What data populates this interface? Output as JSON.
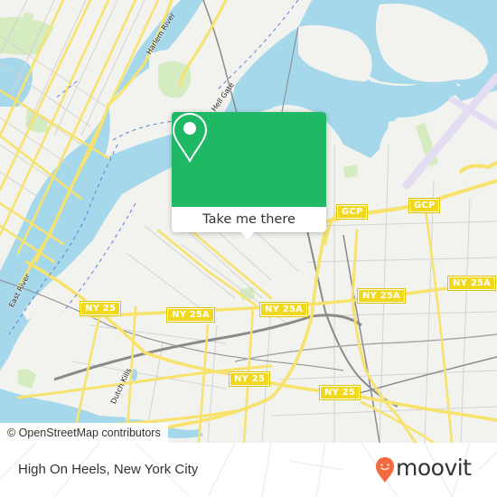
{
  "map": {
    "colors": {
      "land": "#f2f2ee",
      "water": "#a6d8ec",
      "park": "#d5ebc0",
      "major_road": "#f7e26b",
      "major_road_casing": "#e6c85a",
      "minor_road": "#c9c9c9",
      "rail": "#8a8a8a",
      "airport": "#e4ddf1",
      "ferry": "#5a7fd8"
    },
    "labels": {
      "harlem_river": "Harlem River",
      "hell_gate": "Hell Gate",
      "east_river": "East River",
      "dutch_kills": "Dutch Kills"
    },
    "shields": [
      {
        "id": "gcp-1",
        "text": "GCP"
      },
      {
        "id": "gcp-2",
        "text": "GCP"
      },
      {
        "id": "ny25a-1",
        "text": "NY 25A"
      },
      {
        "id": "ny25a-2",
        "text": "NY 25A"
      },
      {
        "id": "ny25a-3",
        "text": "NY 25A"
      },
      {
        "id": "ny25a-4",
        "text": "NY 25A"
      },
      {
        "id": "ny25-1",
        "text": "NY 25"
      },
      {
        "id": "ny25-2",
        "text": "NY 25"
      },
      {
        "id": "ny25-3",
        "text": "NY 25"
      }
    ],
    "attribution": "© OpenStreetMap contributors"
  },
  "popup": {
    "icon": "map-pin-icon",
    "button_label": "Take me there",
    "accent_color": "#1fb865"
  },
  "footer": {
    "place_name": "High On Heels, New York City",
    "logo_text": "moovit",
    "logo_color": "#f26a3d"
  }
}
